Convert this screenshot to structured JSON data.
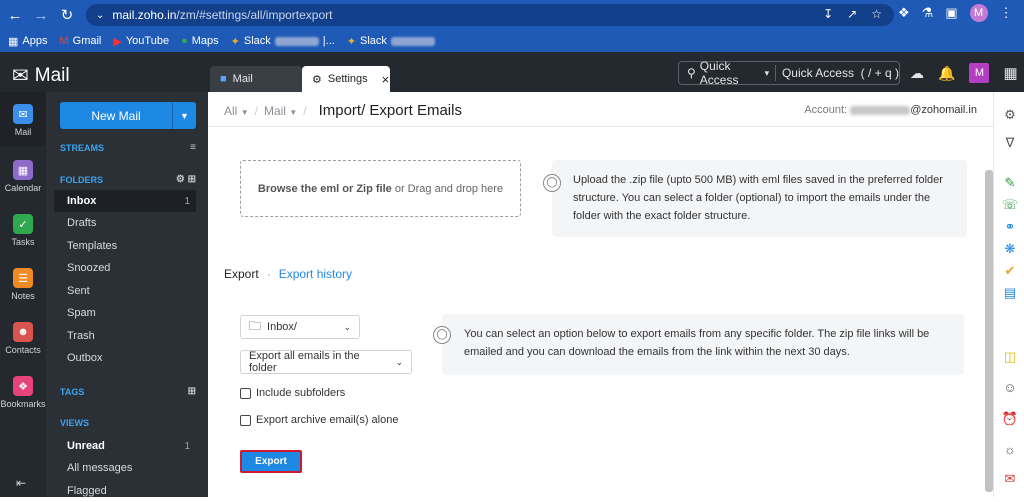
{
  "browser": {
    "url_host": "mail.zoho.in",
    "url_path": "/zm/#settings/all/importexport",
    "profile_initial": "M",
    "bookmarks": [
      {
        "icon": "apps-grid-icon",
        "label": "Apps"
      },
      {
        "icon": "gmail-icon",
        "label": "Gmail"
      },
      {
        "icon": "youtube-icon",
        "label": "YouTube"
      },
      {
        "icon": "maps-icon",
        "label": "Maps"
      },
      {
        "icon": "slack-icon",
        "label": "Slack",
        "suffix": "|..."
      },
      {
        "icon": "slack-icon",
        "label": "Slack",
        "suffix": ""
      }
    ]
  },
  "app": {
    "logo_text": "Mail",
    "tabs": [
      {
        "label": "Mail"
      },
      {
        "label": "Settings"
      }
    ],
    "quick_access_label": "Quick Access",
    "quick_access_hint": "Quick Access  ( / + q )",
    "avatar_initial": "M"
  },
  "rail": [
    {
      "label": "Mail",
      "icon": "mail-icon",
      "color": "#3b8fe8"
    },
    {
      "label": "Calendar",
      "icon": "calendar-icon",
      "color": "#8e6acb"
    },
    {
      "label": "Tasks",
      "icon": "tasks-icon",
      "color": "#2fa84f"
    },
    {
      "label": "Notes",
      "icon": "notes-icon",
      "color": "#f08a24"
    },
    {
      "label": "Contacts",
      "icon": "contacts-icon",
      "color": "#d9534f"
    },
    {
      "label": "Bookmarks",
      "icon": "bookmarks-icon",
      "color": "#e6437b"
    }
  ],
  "nav": {
    "new_mail": "New Mail",
    "streams": "STREAMS",
    "folders": "FOLDERS",
    "folder_items": [
      {
        "label": "Inbox",
        "count": "1"
      },
      {
        "label": "Drafts",
        "count": ""
      },
      {
        "label": "Templates",
        "count": ""
      },
      {
        "label": "Snoozed",
        "count": ""
      },
      {
        "label": "Sent",
        "count": ""
      },
      {
        "label": "Spam",
        "count": ""
      },
      {
        "label": "Trash",
        "count": ""
      },
      {
        "label": "Outbox",
        "count": ""
      }
    ],
    "tags": "TAGS",
    "views": "VIEWS",
    "view_items": [
      {
        "label": "Unread",
        "count": "1"
      },
      {
        "label": "All messages",
        "count": ""
      },
      {
        "label": "Flagged",
        "count": ""
      }
    ]
  },
  "settings": {
    "crumb_all": "All",
    "crumb_mail": "Mail",
    "title": "Import/ Export Emails",
    "account_label": "Account:",
    "account_domain": "@zohomail.in",
    "drop_bold": "Browse the eml or Zip file",
    "drop_rest": " or Drag and drop here",
    "import_info": "Upload the .zip file (upto 500 MB) with eml files saved in the preferred folder structure. You can select a folder (optional) to import the emails under the folder with the exact folder structure.",
    "export_tab": "Export",
    "export_history_tab": "Export history",
    "folder_select": "Inbox/",
    "scope_select": "Export all emails in the folder",
    "export_info": "You can select an option below to export emails from any specific folder. The zip file links will be emailed and you can download the emails from the link within the next 30 days.",
    "include_subfolders": "Include subfolders",
    "archive_alone": "Export archive email(s) alone",
    "export_button": "Export"
  }
}
